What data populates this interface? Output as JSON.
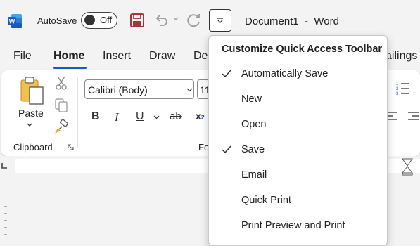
{
  "title_bar": {
    "autosave_label": "AutoSave",
    "autosave_state": "Off",
    "document_title": "Document1  -  Word"
  },
  "tabs": [
    {
      "label": "File"
    },
    {
      "label": "Home",
      "active": true
    },
    {
      "label": "Insert"
    },
    {
      "label": "Draw"
    },
    {
      "label": "De"
    },
    {
      "label": "ailings"
    }
  ],
  "ribbon": {
    "clipboard": {
      "paste_label": "Paste",
      "group_label": "Clipboard"
    },
    "font": {
      "font_name": "Calibri (Body)",
      "font_size": "11",
      "bold": "B",
      "italic": "I",
      "underline": "U",
      "strikethrough": "ab",
      "subscript": "x",
      "subscript_small": "2",
      "group_label": "Fo"
    }
  },
  "qat_menu": {
    "title": "Customize Quick Access Toolbar",
    "items": [
      {
        "label": "Automatically Save",
        "checked": true
      },
      {
        "label": "New",
        "checked": false
      },
      {
        "label": "Open",
        "checked": false
      },
      {
        "label": "Save",
        "checked": true
      },
      {
        "label": "Email",
        "checked": false
      },
      {
        "label": "Quick Print",
        "checked": false
      },
      {
        "label": "Print Preview and Print",
        "checked": false
      }
    ]
  },
  "colors": {
    "accent": "#185abd",
    "save_icon": "#a4373a",
    "word_logo": "#185abd"
  },
  "icons": [
    "word-logo-icon",
    "save-icon",
    "undo-icon",
    "redo-icon",
    "chevron-down-icon",
    "paste-icon",
    "cut-icon",
    "copy-icon",
    "format-painter-icon",
    "dialog-launcher-icon",
    "numbered-list-icon",
    "align-left-icon",
    "align-right-icon",
    "check-icon"
  ]
}
